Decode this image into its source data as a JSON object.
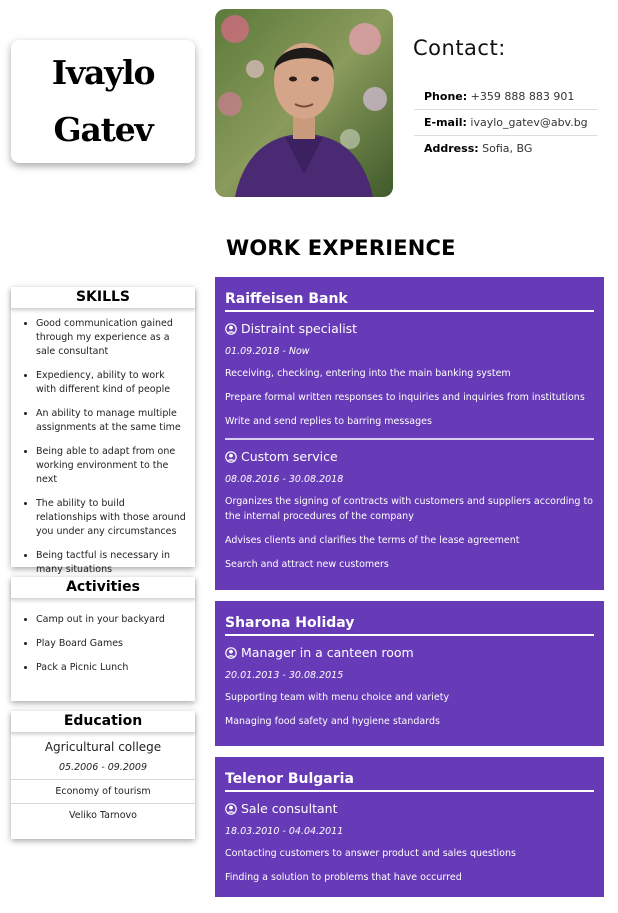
{
  "profile": {
    "first_name": "Ivaylo",
    "last_name": "Gatev"
  },
  "contact": {
    "title": "Contact:",
    "phone_label": "Phone:",
    "phone_value": "+359 888 883 901",
    "email_label": "E-mail:",
    "email_value": "ivaylo_gatev@abv.bg",
    "address_label": "Address:",
    "address_value": "Sofia, BG"
  },
  "work_title": "WORK EXPERIENCE",
  "skills": {
    "title": "SKILLS",
    "items": [
      "Good communication gained through my experience as a sale consultant",
      "Expediency, ability to work with different kind of people",
      "An ability to manage multiple assignments at the same time",
      "Being able to adapt from one working environment to the next",
      "The ability to build relationships with those around you under any circumstances",
      "Being tactful is necessary in many situations"
    ]
  },
  "activities": {
    "title": "Activities",
    "items": [
      "Camp out in your backyard",
      "Play Board Games",
      "Pack a Picnic Lunch"
    ]
  },
  "education": {
    "title": "Education",
    "school": "Agricultural college",
    "period": "05.2006 - 09.2009",
    "field": "Economy of tourism",
    "location": "Veliko Tarnovo"
  },
  "jobs": [
    {
      "company": "Raiffeisen Bank",
      "roles": [
        {
          "title": "Distraint specialist",
          "period": "01.09.2018 - Now",
          "duties": [
            "Receiving, checking, entering into the main banking system",
            "Prepare formal written responses to inquiries and inquiries from institutions",
            "Write and send replies to barring messages"
          ]
        },
        {
          "title": "Custom service",
          "period": "08.08.2016 - 30.08.2018",
          "duties": [
            "Organizes the signing of contracts with customers and suppliers according to the internal procedures of the company",
            "Advises clients and clarifies the terms of the lease agreement",
            "Search and attract new customers"
          ]
        }
      ]
    },
    {
      "company": "Sharona Holiday",
      "roles": [
        {
          "title": "Manager in a canteen room",
          "period": "20.01.2013 - 30.08.2015",
          "duties": [
            "Supporting team with menu choice and variety",
            "Managing food safety and hygiene standards"
          ]
        }
      ]
    },
    {
      "company": "Telenor Bulgaria",
      "roles": [
        {
          "title": "Sale consultant",
          "period": "18.03.2010 - 04.04.2011",
          "duties": [
            "Contacting customers to answer product and sales questions",
            "Finding a solution to problems that have occurred"
          ]
        }
      ]
    }
  ],
  "colors": {
    "accent": "#673ab7"
  },
  "icons": {
    "role_icon": "user-circle-icon"
  }
}
